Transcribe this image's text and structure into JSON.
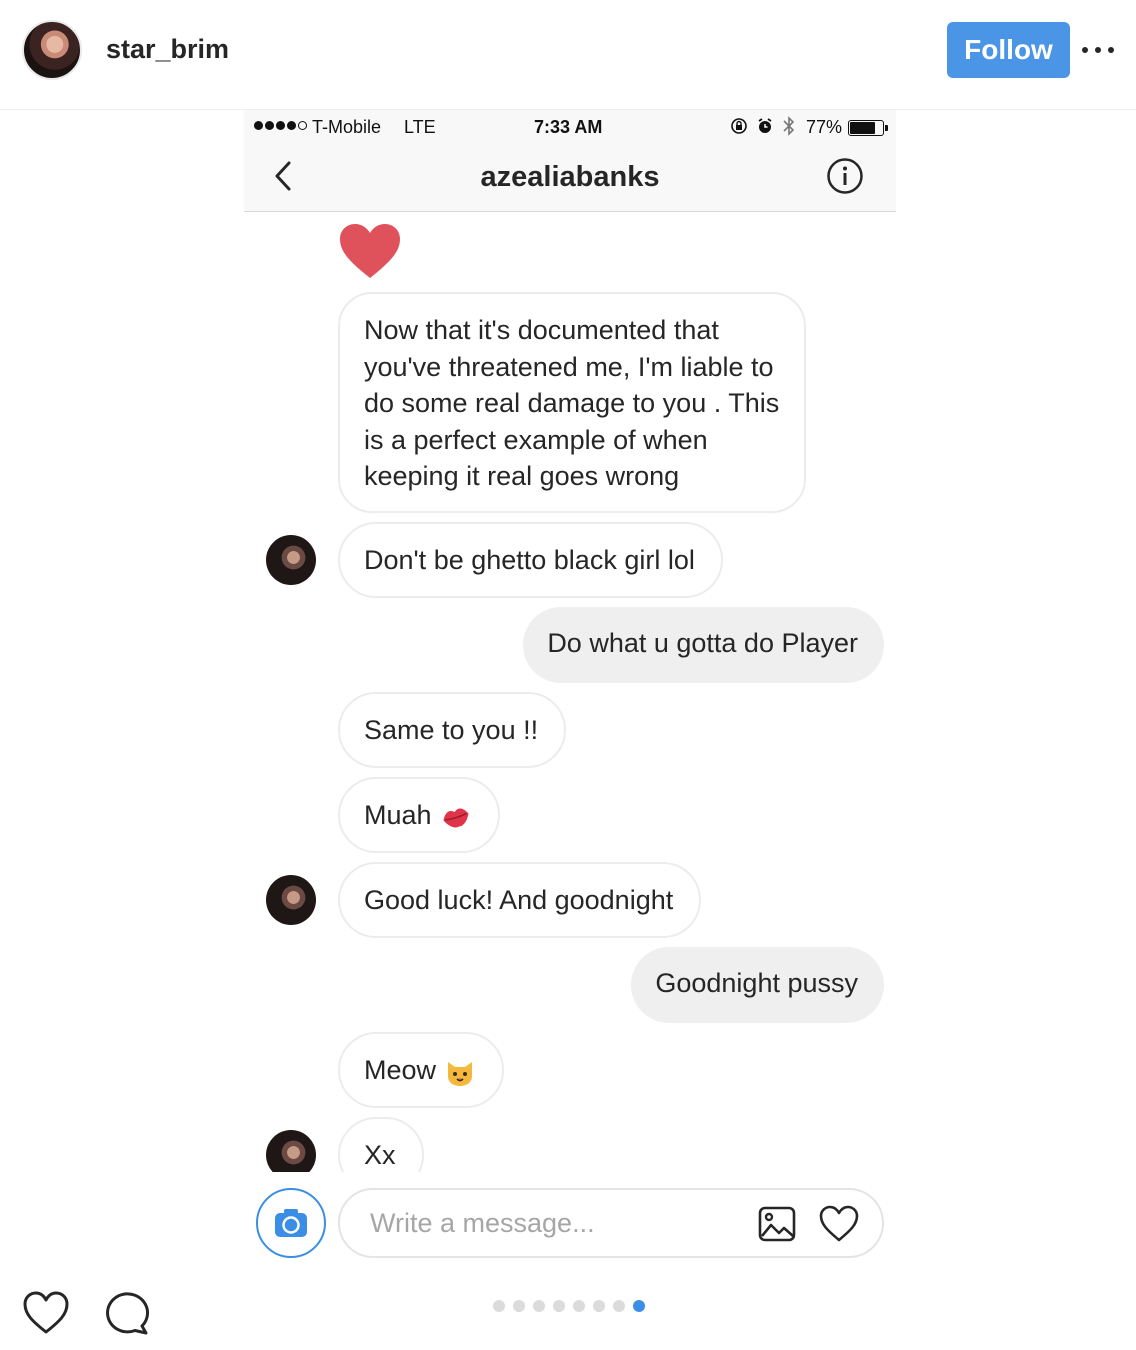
{
  "post": {
    "username": "star_brim",
    "follow_label": "Follow",
    "accent_color": "#4a95e6"
  },
  "status_bar": {
    "carrier": "T-Mobile",
    "network": "LTE",
    "time": "7:33 AM",
    "battery": "77%",
    "battery_level": 0.77,
    "signal_bars": 4
  },
  "thread": {
    "title": "azealiabanks",
    "messages": [
      {
        "side": "in",
        "text": "Now that it's documented that you've threatened me, I'm liable to do some real damage to you . This is a perfect example of when keeping it real goes wrong"
      },
      {
        "side": "in",
        "text": "Don't be ghetto black girl lol",
        "avatar": true
      },
      {
        "side": "out",
        "text": "Do what u gotta do Player"
      },
      {
        "side": "in",
        "text": "Same to you !!"
      },
      {
        "side": "in",
        "text": "Muah",
        "emoji": "kiss-lips-emoji"
      },
      {
        "side": "in",
        "text": "Good luck! And goodnight",
        "avatar": true
      },
      {
        "side": "out",
        "text": "Goodnight pussy"
      },
      {
        "side": "in",
        "text": "Meow",
        "emoji": "cat-face-emoji"
      },
      {
        "side": "in",
        "text": "Xx",
        "avatar": true
      }
    ]
  },
  "composer": {
    "placeholder": "Write a message..."
  },
  "carousel": {
    "total": 8,
    "active": 8
  }
}
